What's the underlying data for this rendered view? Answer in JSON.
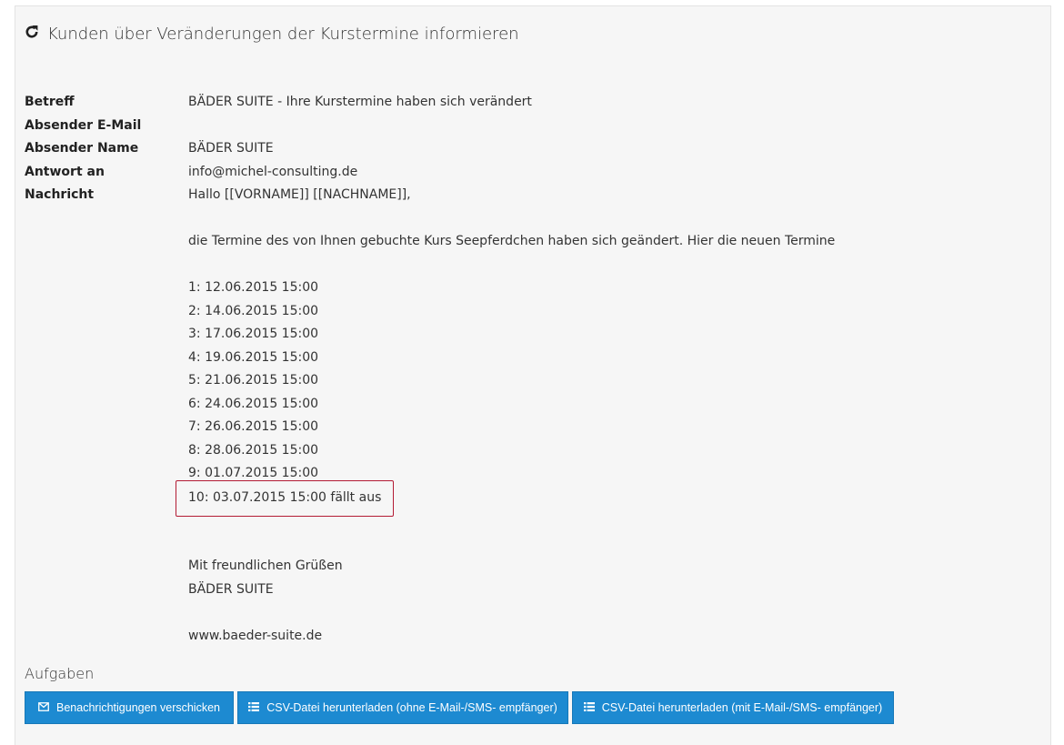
{
  "header": {
    "icon": "refresh-icon",
    "title": "Kunden über Veränderungen der Kurstermine informieren"
  },
  "fields": [
    {
      "label": "Betreff",
      "value": "BÄDER SUITE - Ihre Kurstermine haben sich verändert"
    },
    {
      "label": "Absender E-Mail",
      "value": ""
    },
    {
      "label": "Absender Name",
      "value": "BÄDER SUITE"
    },
    {
      "label": "Antwort an",
      "value": "info@michel-consulting.de"
    },
    {
      "label": "Nachricht",
      "value": "Hallo [[VORNAME]] [[NACHNAME]],"
    }
  ],
  "message": {
    "intro": "die Termine des von Ihnen gebuchte Kurs Seepferdchen haben sich geändert. Hier die neuen Termine",
    "dates": [
      "1: 12.06.2015 15:00",
      "2: 14.06.2015 15:00",
      "3: 17.06.2015 15:00",
      "4: 19.06.2015 15:00",
      "5: 21.06.2015 15:00",
      "6: 24.06.2015 15:00",
      "7: 26.06.2015 15:00",
      "8: 28.06.2015 15:00",
      "9: 01.07.2015 15:00",
      "10: 03.07.2015 15:00 fällt aus"
    ],
    "closing": "Mit freundlichen Grüßen",
    "signature": "BÄDER SUITE",
    "website": "www.baeder-suite.de"
  },
  "tasks": {
    "label": "Aufgaben",
    "buttons": [
      {
        "label": "Benachrichtigungen verschicken",
        "icon": "envelope-icon"
      },
      {
        "label": "CSV-Datei herunterladen (ohne E-Mail-/SMS- empfänger)",
        "icon": "list-icon"
      },
      {
        "label": "CSV-Datei herunterladen (mit E-Mail-/SMS- empfänger)",
        "icon": "list-icon"
      }
    ]
  },
  "colors": {
    "button": "#1d8ad1",
    "highlight_border": "#b31b34",
    "panel_background": "#f6f6f6"
  }
}
